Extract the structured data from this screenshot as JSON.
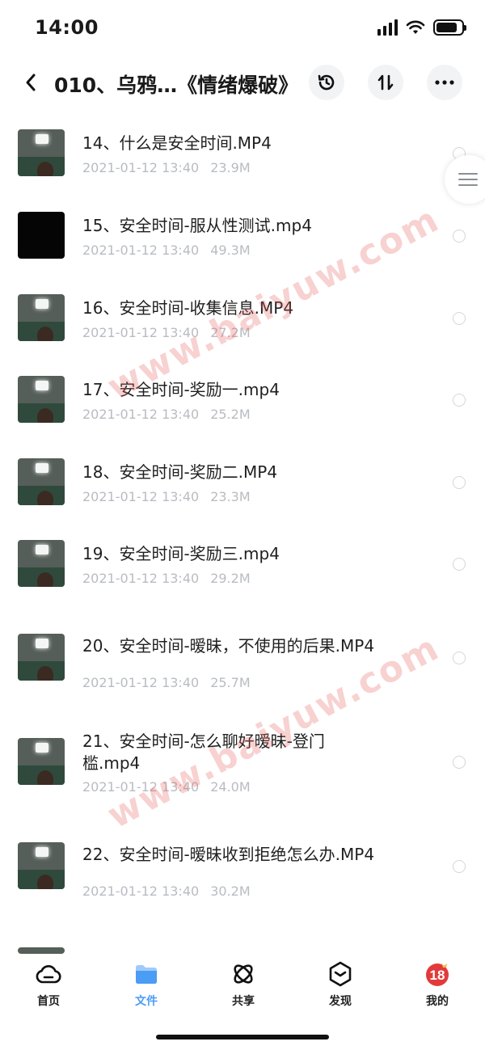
{
  "status_bar": {
    "time": "14:00"
  },
  "header": {
    "title": "010、乌鸦…《情绪爆破》"
  },
  "files": [
    {
      "name": "14、什么是安全时间.MP4",
      "date": "2021-01-12 13:40",
      "size": "23.9M"
    },
    {
      "name": "15、安全时间-服从性测试.mp4",
      "date": "2021-01-12 13:40",
      "size": "49.3M"
    },
    {
      "name": "16、安全时间-收集信息.MP4",
      "date": "2021-01-12 13:40",
      "size": "27.2M"
    },
    {
      "name": "17、安全时间-奖励一.mp4",
      "date": "2021-01-12 13:40",
      "size": "25.2M"
    },
    {
      "name": "18、安全时间-奖励二.MP4",
      "date": "2021-01-12 13:40",
      "size": "23.3M"
    },
    {
      "name": "19、安全时间-奖励三.mp4",
      "date": "2021-01-12 13:40",
      "size": "29.2M"
    },
    {
      "name": "20、安全时间-暧昧，不使用的后果.MP4",
      "date": "2021-01-12 13:40",
      "size": "25.7M"
    },
    {
      "name": "21、安全时间-怎么聊好暧昧-登门槛.mp4",
      "date": "2021-01-12 13:40",
      "size": "24.0M"
    },
    {
      "name": "22、安全时间-暧昧收到拒绝怎么办.MP4",
      "date": "2021-01-12 13:40",
      "size": "30.2M"
    }
  ],
  "watermark": "www.baiyuw.com",
  "tabs": [
    {
      "label": "首页",
      "icon": "cloud-icon"
    },
    {
      "label": "文件",
      "icon": "folder-icon"
    },
    {
      "label": "共享",
      "icon": "share-atom-icon"
    },
    {
      "label": "发现",
      "icon": "discover-icon"
    },
    {
      "label": "我的",
      "icon": "profile-badge-icon",
      "badge": "18"
    }
  ],
  "colors": {
    "accent": "#4a9cf5",
    "meta_text": "#b8bcc2",
    "watermark": "#e65a5a"
  }
}
